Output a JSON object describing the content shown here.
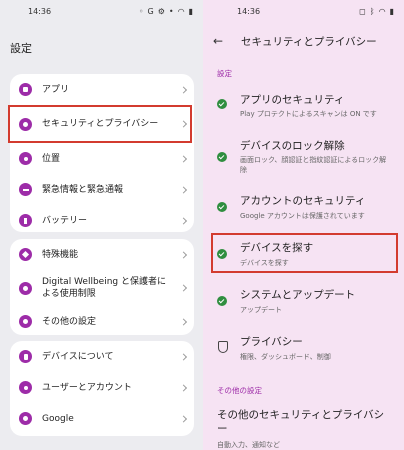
{
  "left": {
    "status": {
      "time": "14:36",
      "icons": [
        "signal-icon",
        "circle-g-icon",
        "gear-icon",
        "dot-icon"
      ]
    },
    "title": "設定",
    "card1": [
      {
        "label": "アプリ",
        "icon": "apps-icon"
      },
      {
        "label": "セキュリティとプライバシー",
        "icon": "security-icon"
      },
      {
        "label": "位置",
        "icon": "location-icon"
      },
      {
        "label": "緊急情報と緊急通報",
        "icon": "emergency-icon"
      },
      {
        "label": "バッテリー",
        "icon": "battery-icon"
      }
    ],
    "card2": [
      {
        "label": "特殊機能",
        "icon": "star-icon"
      },
      {
        "label": "Digital Wellbeing と保護者による使用制限",
        "icon": "wellbeing-icon"
      },
      {
        "label": "その他の設定",
        "icon": "gear-icon"
      }
    ],
    "card3": [
      {
        "label": "デバイスについて",
        "icon": "phone-icon"
      },
      {
        "label": "ユーザーとアカウント",
        "icon": "user-icon"
      },
      {
        "label": "Google",
        "icon": "google-icon"
      }
    ]
  },
  "right": {
    "status": {
      "time": "14:36"
    },
    "title": "セキュリティとプライバシー",
    "section1": "設定",
    "items": [
      {
        "title": "アプリのセキュリティ",
        "sub": "Play プロテクトによるスキャンは ON です",
        "status": "ok"
      },
      {
        "title": "デバイスのロック解除",
        "sub": "画面ロック、顔認証と指紋認証によるロック解除",
        "status": "ok"
      },
      {
        "title": "アカウントのセキュリティ",
        "sub": "Google アカウントは保護されています",
        "status": "ok"
      },
      {
        "title": "デバイスを探す",
        "sub": "デバイスを探す",
        "status": "ok"
      },
      {
        "title": "システムとアップデート",
        "sub": "アップデート",
        "status": "ok"
      },
      {
        "title": "プライバシー",
        "sub": "権限、ダッシュボード、制御",
        "status": "privacy"
      }
    ],
    "section2": "その他の設定",
    "more": {
      "title": "その他のセキュリティとプライバシー",
      "sub": "自動入力、通知など"
    }
  },
  "colors": {
    "accent": "#9d2ca8",
    "ok": "#2f8e3f",
    "highlight": "#d33b2f"
  }
}
